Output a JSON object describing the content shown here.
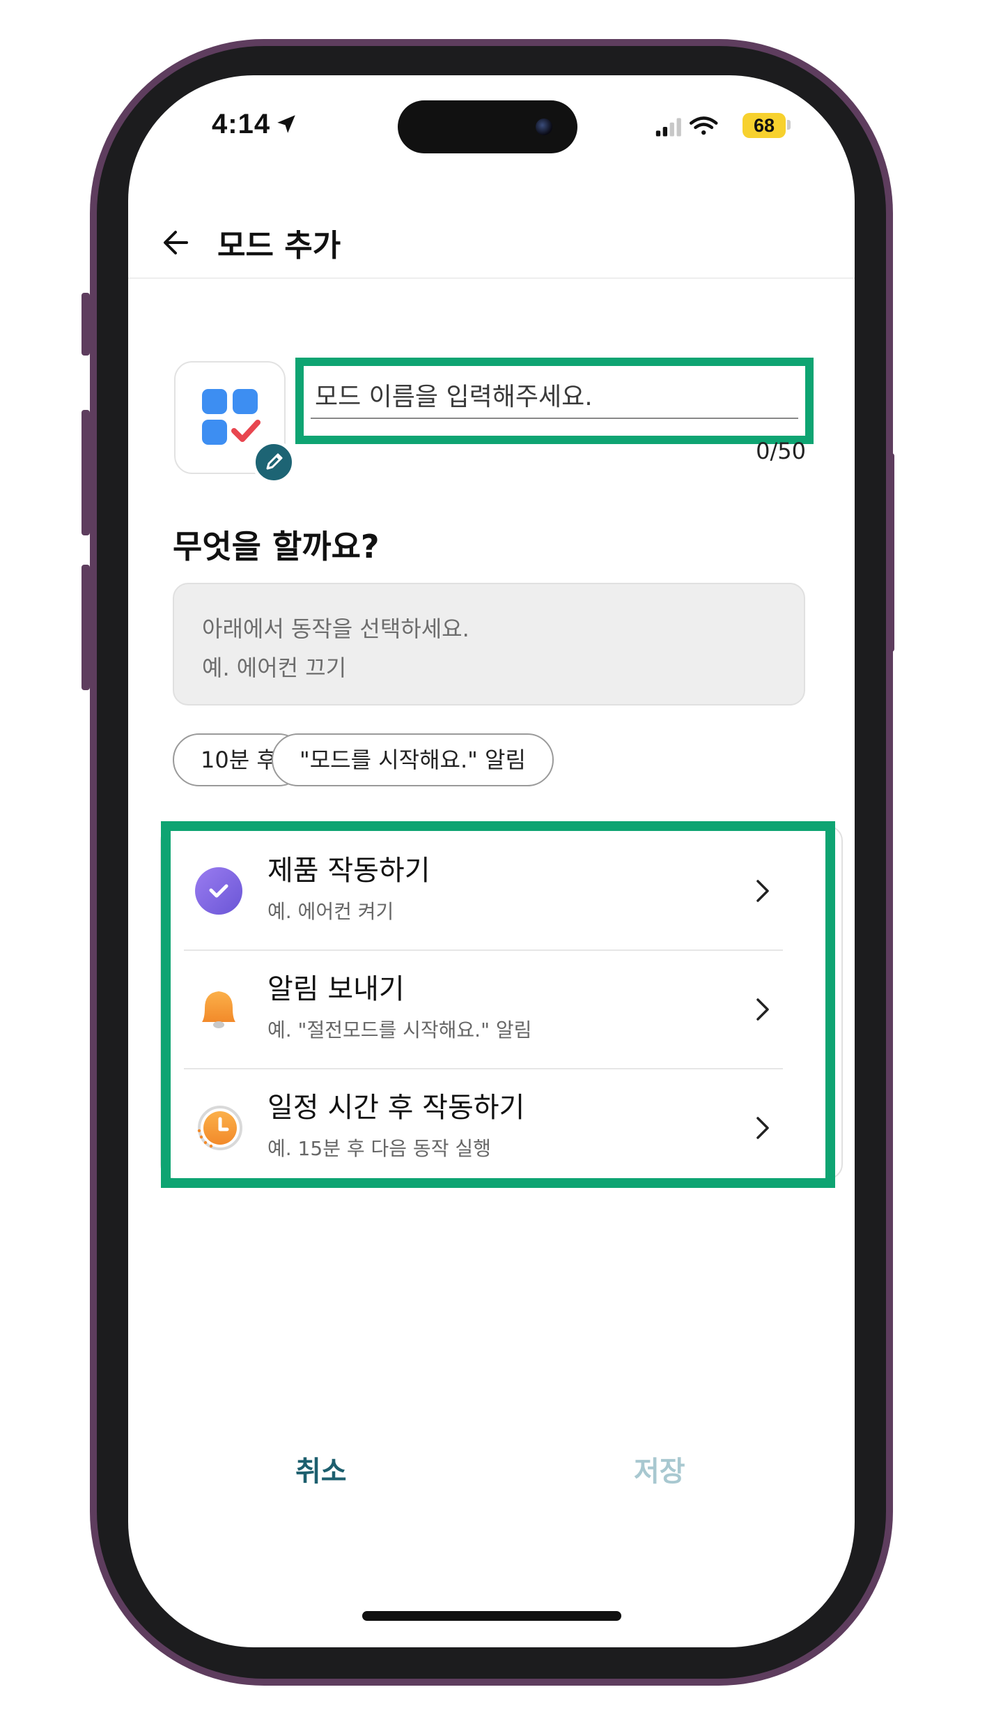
{
  "status_bar": {
    "time": "4:14",
    "battery": "68",
    "icons": [
      "location-arrow-icon",
      "cellular-signal-icon",
      "wifi-icon",
      "battery-icon"
    ]
  },
  "header": {
    "title": "모드 추가",
    "back_icon": "arrow-left-icon"
  },
  "mode_name": {
    "placeholder": "모드 이름을 입력해주세요.",
    "value": "",
    "char_count": "0/50",
    "icon": "apps-check-icon",
    "edit_icon": "pencil-icon"
  },
  "question": "무엇을 할까요?",
  "action_hint": {
    "line1": "아래에서 동작을 선택하세요.",
    "line2": "예. 에어컨 끄기"
  },
  "chips": [
    "10분 후",
    "\"모드를 시작해요.\" 알림"
  ],
  "options": [
    {
      "title": "제품 작동하기",
      "subtitle": "예. 에어컨 켜기",
      "icon": "check-circle-icon",
      "color": "#8b6fe0"
    },
    {
      "title": "알림 보내기",
      "subtitle": "예. \"절전모드를 시작해요.\" 알림",
      "icon": "bell-icon",
      "color": "#f7a33c"
    },
    {
      "title": "일정 시간 후 작동하기",
      "subtitle": "예. 15분 후 다음 동작 실행",
      "icon": "clock-icon",
      "color": "#f7a33c"
    }
  ],
  "footer": {
    "cancel": "취소",
    "save": "저장",
    "cancel_color": "#1d5f6e",
    "save_color": "#a8c8d0"
  },
  "highlight_color": "#0ea472"
}
